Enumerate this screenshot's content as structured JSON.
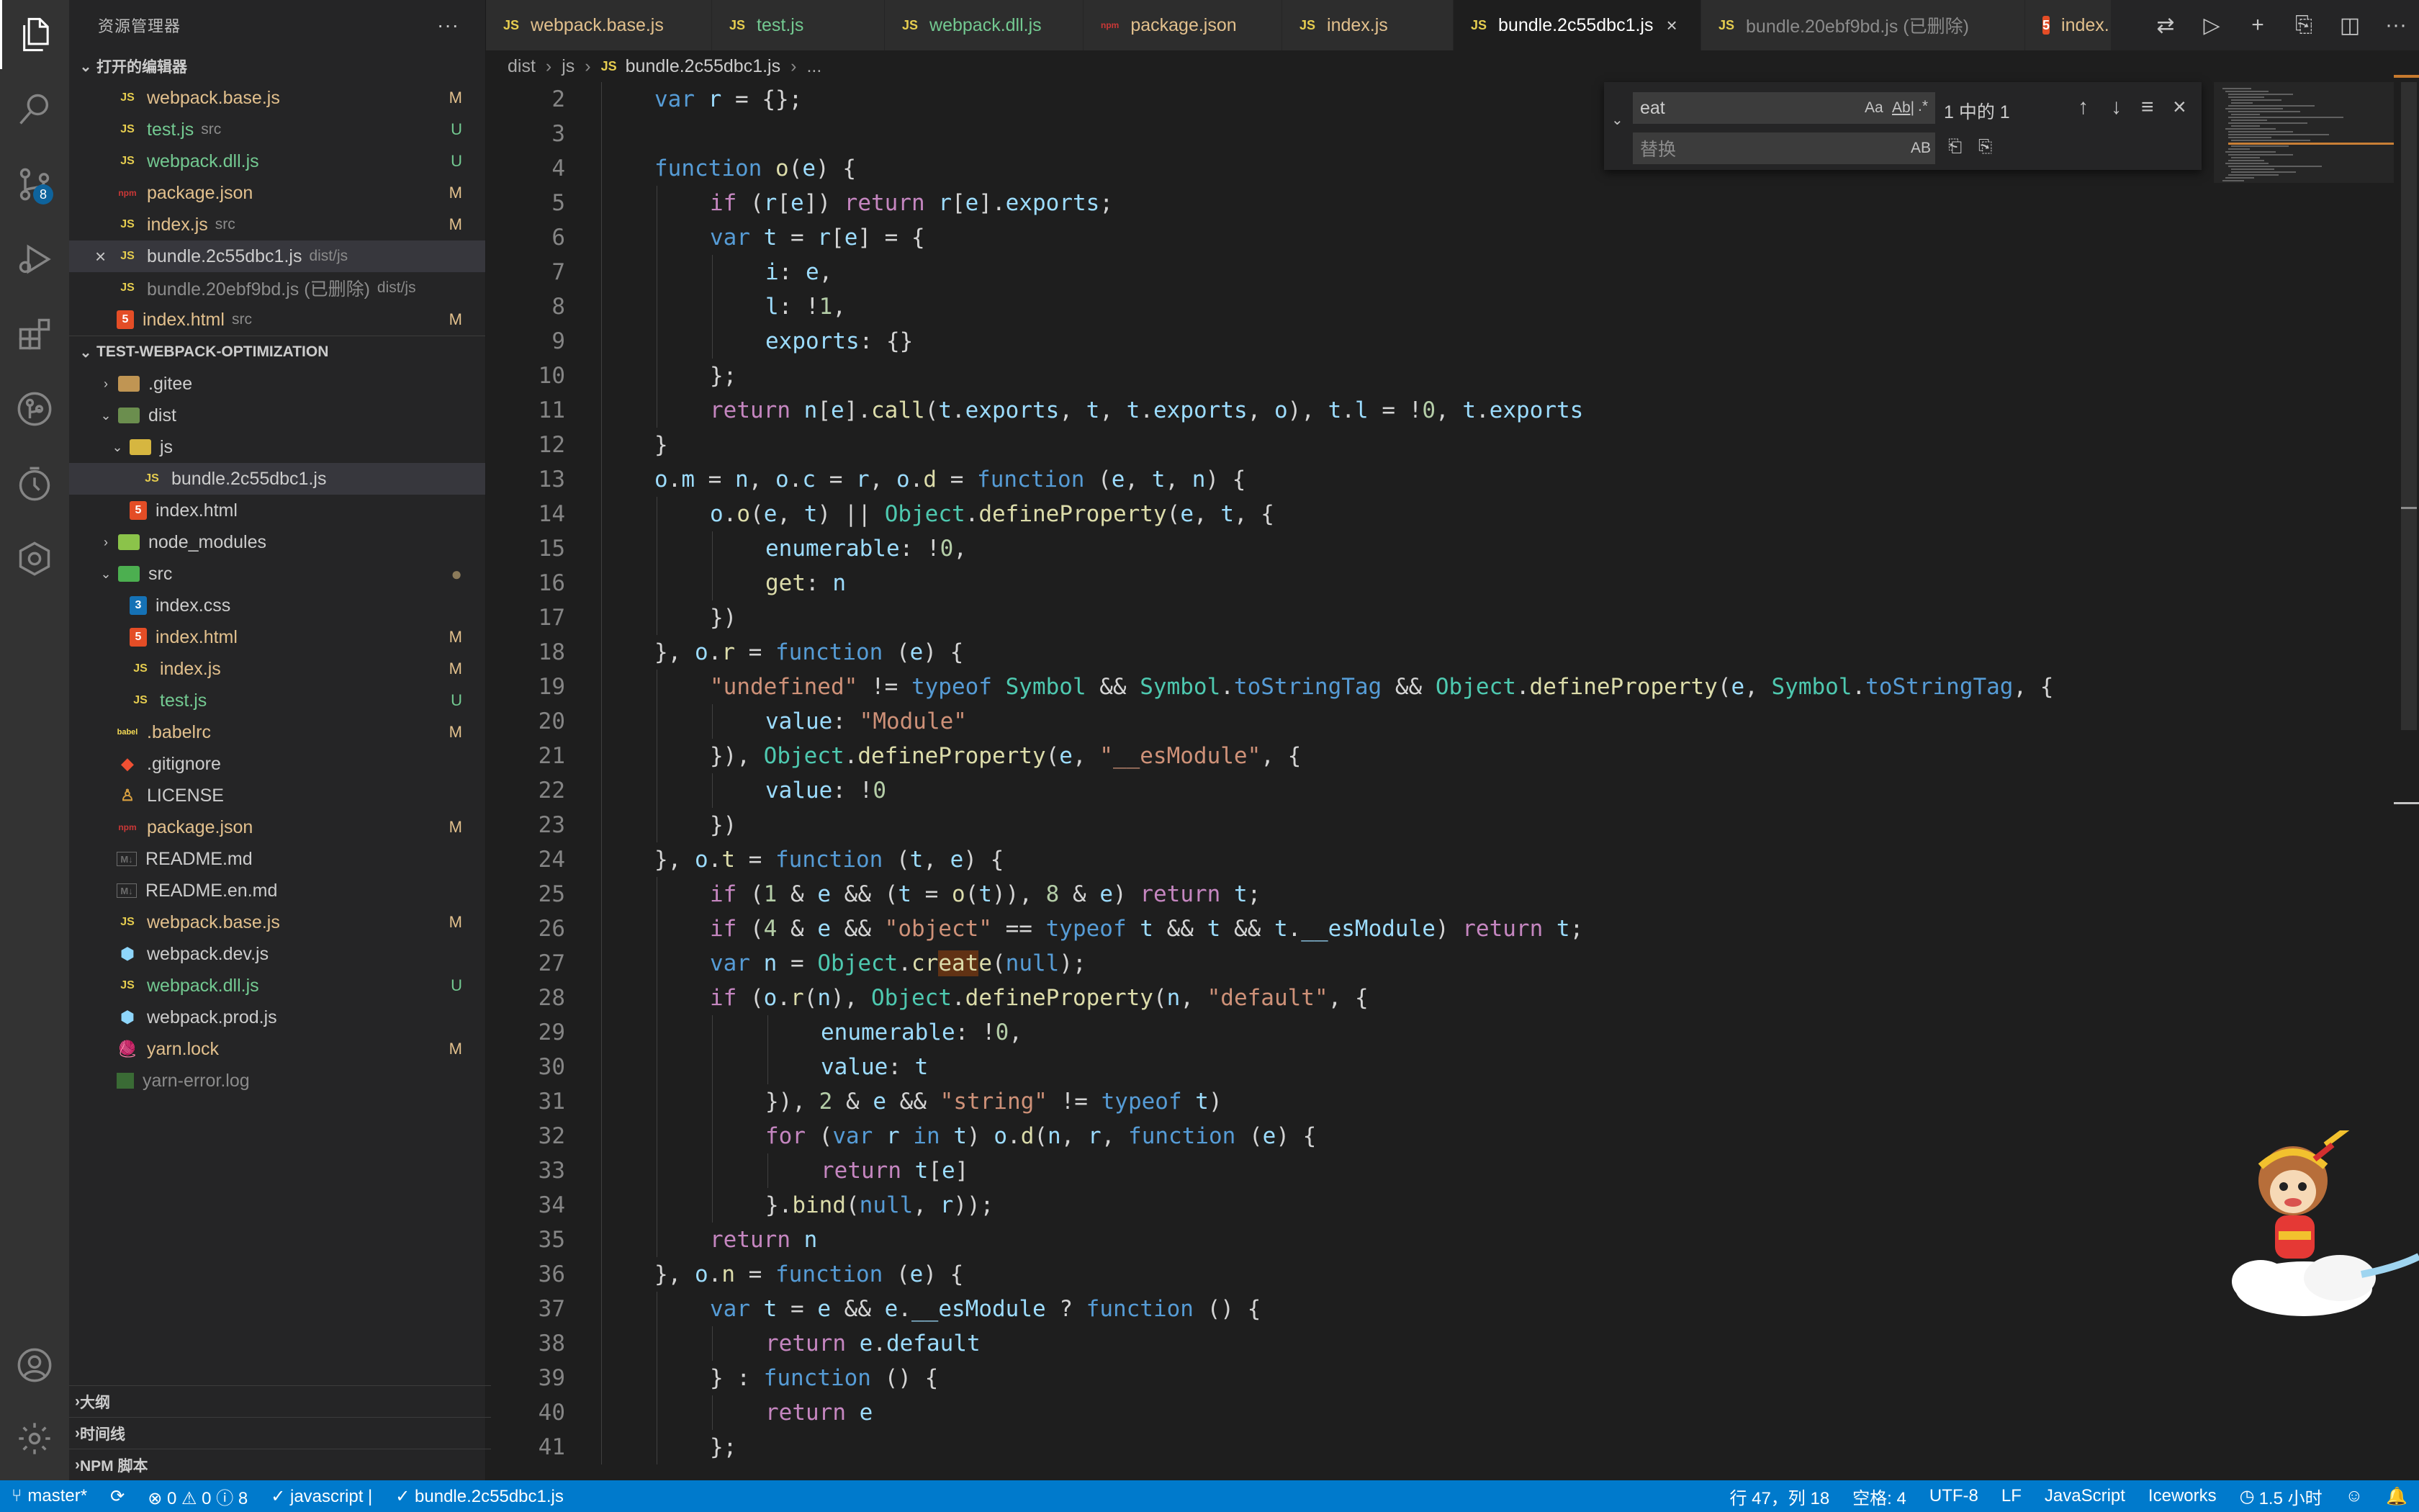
{
  "sidebar": {
    "title": "资源管理器",
    "more": "···",
    "open_editors": {
      "title": "打开的编辑器",
      "items": [
        {
          "name": "webpack.base.js",
          "desc": "",
          "status": "M",
          "type": "js"
        },
        {
          "name": "test.js",
          "desc": "src",
          "status": "U",
          "type": "js"
        },
        {
          "name": "webpack.dll.js",
          "desc": "",
          "status": "U",
          "type": "js"
        },
        {
          "name": "package.json",
          "desc": "",
          "status": "M",
          "type": "npm"
        },
        {
          "name": "index.js",
          "desc": "src",
          "status": "M",
          "type": "js"
        },
        {
          "name": "bundle.2c55dbc1.js",
          "desc": "dist/js",
          "status": "",
          "type": "js"
        },
        {
          "name": "bundle.20ebf9bd.js (已删除)",
          "desc": "dist/js",
          "status": "",
          "type": "js"
        },
        {
          "name": "index.html",
          "desc": "src",
          "status": "M",
          "type": "html"
        }
      ]
    },
    "project": {
      "title": "TEST-WEBPACK-OPTIMIZATION",
      "items": [
        {
          "name": ".gitee",
          "status": ""
        },
        {
          "name": "dist",
          "status": ""
        },
        {
          "name": "js",
          "status": ""
        },
        {
          "name": "bundle.2c55dbc1.js",
          "status": ""
        },
        {
          "name": "index.html",
          "status": ""
        },
        {
          "name": "node_modules",
          "status": ""
        },
        {
          "name": "src",
          "status": ""
        },
        {
          "name": "index.css",
          "status": ""
        },
        {
          "name": "index.html",
          "status": "M"
        },
        {
          "name": "index.js",
          "status": "M"
        },
        {
          "name": "test.js",
          "status": "U"
        },
        {
          "name": ".babelrc",
          "status": "M"
        },
        {
          "name": ".gitignore",
          "status": ""
        },
        {
          "name": "LICENSE",
          "status": ""
        },
        {
          "name": "package.json",
          "status": "M"
        },
        {
          "name": "README.md",
          "status": ""
        },
        {
          "name": "README.en.md",
          "status": ""
        },
        {
          "name": "webpack.base.js",
          "status": "M"
        },
        {
          "name": "webpack.dev.js",
          "status": ""
        },
        {
          "name": "webpack.dll.js",
          "status": "U"
        },
        {
          "name": "webpack.prod.js",
          "status": ""
        },
        {
          "name": "yarn.lock",
          "status": "M"
        },
        {
          "name": "yarn-error.log",
          "status": ""
        }
      ]
    },
    "outline": "大纲",
    "timeline": "时间线",
    "npm": "NPM 脚本"
  },
  "activity": {
    "scm_badge": "8"
  },
  "tabs": [
    {
      "label": "webpack.base.js",
      "icon": "JS"
    },
    {
      "label": "test.js",
      "icon": "JS"
    },
    {
      "label": "webpack.dll.js",
      "icon": "JS"
    },
    {
      "label": "package.json",
      "icon": "npm"
    },
    {
      "label": "index.js",
      "icon": "JS"
    },
    {
      "label": "bundle.2c55dbc1.js",
      "icon": "JS",
      "active": true
    },
    {
      "label": "bundle.20ebf9bd.js (已删除)",
      "icon": "JS"
    },
    {
      "label": "index.",
      "icon": "5"
    }
  ],
  "breadcrumb": [
    "dist",
    "js",
    "bundle.2c55dbc1.js",
    "..."
  ],
  "find": {
    "search_value": "eat",
    "replace_placeholder": "替换",
    "opt_case": "Aa",
    "opt_word": "Ab|",
    "opt_regex": ".*",
    "opt_preserve": "AB",
    "result": "1 中的 1"
  },
  "editor": {
    "lines": [
      {
        "n": "2",
        "indent": 1,
        "html": "<span class='kw'>var</span> <span class='vr'>r</span> = {};"
      },
      {
        "n": "3",
        "indent": 1,
        "html": ""
      },
      {
        "n": "4",
        "indent": 1,
        "html": "<span class='kw'>function</span> <span class='fn'>o</span>(<span class='vr'>e</span>) {"
      },
      {
        "n": "5",
        "indent": 2,
        "html": "<span class='kc'>if</span> (<span class='vr'>r</span>[<span class='vr'>e</span>]) <span class='kc'>return</span> <span class='vr'>r</span>[<span class='vr'>e</span>].<span class='vr'>exports</span>;"
      },
      {
        "n": "6",
        "indent": 2,
        "html": "<span class='kw'>var</span> <span class='vr'>t</span> = <span class='vr'>r</span>[<span class='vr'>e</span>] = {"
      },
      {
        "n": "7",
        "indent": 3,
        "html": "<span class='vr'>i</span>: <span class='vr'>e</span>,"
      },
      {
        "n": "8",
        "indent": 3,
        "html": "<span class='vr'>l</span>: !<span class='nm'>1</span>,"
      },
      {
        "n": "9",
        "indent": 3,
        "html": "<span class='vr'>exports</span>: {}"
      },
      {
        "n": "10",
        "indent": 2,
        "html": "};"
      },
      {
        "n": "11",
        "indent": 2,
        "html": "<span class='kc'>return</span> <span class='vr'>n</span>[<span class='vr'>e</span>].<span class='fn'>call</span>(<span class='vr'>t</span>.<span class='vr'>exports</span>, <span class='vr'>t</span>, <span class='vr'>t</span>.<span class='vr'>exports</span>, <span class='vr'>o</span>), <span class='vr'>t</span>.<span class='vr'>l</span> = !<span class='nm'>0</span>, <span class='vr'>t</span>.<span class='vr'>exports</span>"
      },
      {
        "n": "12",
        "indent": 1,
        "html": "}"
      },
      {
        "n": "13",
        "indent": 1,
        "html": "<span class='vr'>o</span>.<span class='vr'>m</span> = <span class='vr'>n</span>, <span class='vr'>o</span>.<span class='vr'>c</span> = <span class='vr'>r</span>, <span class='vr'>o</span>.<span class='fn'>d</span> = <span class='kw'>function</span> (<span class='vr'>e</span>, <span class='vr'>t</span>, <span class='vr'>n</span>) {"
      },
      {
        "n": "14",
        "indent": 2,
        "html": "<span class='vr'>o</span>.<span class='fn'>o</span>(<span class='vr'>e</span>, <span class='vr'>t</span>) || <span class='cl'>Object</span>.<span class='fn'>defineProperty</span>(<span class='vr'>e</span>, <span class='vr'>t</span>, {"
      },
      {
        "n": "15",
        "indent": 3,
        "html": "<span class='vr'>enumerable</span>: !<span class='nm'>0</span>,"
      },
      {
        "n": "16",
        "indent": 3,
        "html": "<span class='fn'>get</span>: <span class='vr'>n</span>"
      },
      {
        "n": "17",
        "indent": 2,
        "html": "})"
      },
      {
        "n": "18",
        "indent": 1,
        "html": "}, <span class='vr'>o</span>.<span class='fn'>r</span> = <span class='kw'>function</span> (<span class='vr'>e</span>) {"
      },
      {
        "n": "19",
        "indent": 2,
        "html": "<span class='st'>\"undefined\"</span> != <span class='kw'>typeof</span> <span class='cl'>Symbol</span> &amp;&amp; <span class='cl'>Symbol</span>.<span class='kw'>toStringTag</span> &amp;&amp; <span class='cl'>Object</span>.<span class='fn'>defineProperty</span>(<span class='vr'>e</span>, <span class='cl'>Symbol</span>.<span class='kw'>toStringTag</span>, {"
      },
      {
        "n": "20",
        "indent": 3,
        "html": "<span class='vr'>value</span>: <span class='st'>\"Module\"</span>"
      },
      {
        "n": "21",
        "indent": 2,
        "html": "}), <span class='cl'>Object</span>.<span class='fn'>defineProperty</span>(<span class='vr'>e</span>, <span class='st'>\"__esModule\"</span>, {"
      },
      {
        "n": "22",
        "indent": 3,
        "html": "<span class='vr'>value</span>: !<span class='nm'>0</span>"
      },
      {
        "n": "23",
        "indent": 2,
        "html": "})"
      },
      {
        "n": "24",
        "indent": 1,
        "html": "}, <span class='vr'>o</span>.<span class='fn'>t</span> = <span class='kw'>function</span> (<span class='vr'>t</span>, <span class='vr'>e</span>) {"
      },
      {
        "n": "25",
        "indent": 2,
        "html": "<span class='kc'>if</span> (<span class='nm'>1</span> &amp; <span class='vr'>e</span> &amp;&amp; (<span class='vr'>t</span> = <span class='fn'>o</span>(<span class='vr'>t</span>)), <span class='nm'>8</span> &amp; <span class='vr'>e</span>) <span class='kc'>return</span> <span class='vr'>t</span>;"
      },
      {
        "n": "26",
        "indent": 2,
        "html": "<span class='kc'>if</span> (<span class='nm'>4</span> &amp; <span class='vr'>e</span> &amp;&amp; <span class='st'>\"object\"</span> == <span class='kw'>typeof</span> <span class='vr'>t</span> &amp;&amp; <span class='vr'>t</span> &amp;&amp; <span class='vr'>t</span>.<span class='vr'>__esModule</span>) <span class='kc'>return</span> <span class='vr'>t</span>;"
      },
      {
        "n": "27",
        "indent": 2,
        "html": "<span class='kw'>var</span> <span class='vr'>n</span> = <span class='cl'>Object</span>.<span class='fn'>cr<span class='hl'>eat</span>e</span>(<span class='kw'>null</span>);"
      },
      {
        "n": "28",
        "indent": 2,
        "html": "<span class='kc'>if</span> (<span class='vr'>o</span>.<span class='fn'>r</span>(<span class='vr'>n</span>), <span class='cl'>Object</span>.<span class='fn'>defineProperty</span>(<span class='vr'>n</span>, <span class='st'>\"default\"</span>, {"
      },
      {
        "n": "29",
        "indent": 4,
        "html": "<span class='vr'>enumerable</span>: !<span class='nm'>0</span>,"
      },
      {
        "n": "30",
        "indent": 4,
        "html": "<span class='vr'>value</span>: <span class='vr'>t</span>"
      },
      {
        "n": "31",
        "indent": 3,
        "html": "}), <span class='nm'>2</span> &amp; <span class='vr'>e</span> &amp;&amp; <span class='st'>\"string\"</span> != <span class='kw'>typeof</span> <span class='vr'>t</span>)"
      },
      {
        "n": "32",
        "indent": 3,
        "html": "<span class='kc'>for</span> (<span class='kw'>var</span> <span class='vr'>r</span> <span class='kw'>in</span> <span class='vr'>t</span>) <span class='vr'>o</span>.<span class='fn'>d</span>(<span class='vr'>n</span>, <span class='vr'>r</span>, <span class='kw'>function</span> (<span class='vr'>e</span>) {"
      },
      {
        "n": "33",
        "indent": 4,
        "html": "<span class='kc'>return</span> <span class='vr'>t</span>[<span class='vr'>e</span>]"
      },
      {
        "n": "34",
        "indent": 3,
        "html": "}.<span class='fn'>bind</span>(<span class='kw'>null</span>, <span class='vr'>r</span>));"
      },
      {
        "n": "35",
        "indent": 2,
        "html": "<span class='kc'>return</span> <span class='vr'>n</span>"
      },
      {
        "n": "36",
        "indent": 1,
        "html": "}, <span class='vr'>o</span>.<span class='fn'>n</span> = <span class='kw'>function</span> (<span class='vr'>e</span>) {"
      },
      {
        "n": "37",
        "indent": 2,
        "html": "<span class='kw'>var</span> <span class='vr'>t</span> = <span class='vr'>e</span> &amp;&amp; <span class='vr'>e</span>.<span class='vr'>__esModule</span> ? <span class='kw'>function</span> () {"
      },
      {
        "n": "38",
        "indent": 3,
        "html": "<span class='kc'>return</span> <span class='vr'>e</span>.<span class='vr'>default</span>"
      },
      {
        "n": "39",
        "indent": 2,
        "html": "} : <span class='kw'>function</span> () {"
      },
      {
        "n": "40",
        "indent": 3,
        "html": "<span class='kc'>return</span> <span class='vr'>e</span>"
      },
      {
        "n": "41",
        "indent": 2,
        "html": "};"
      }
    ]
  },
  "status": {
    "branch": "master*",
    "problems": "⊗ 0 ⚠ 0 ⓘ 8",
    "lang_check": "✓ javascript |",
    "file_check": "✓ bundle.2c55dbc1.js",
    "position": "行 47，列 18",
    "spaces": "空格: 4",
    "encoding": "UTF-8",
    "eol": "LF",
    "language": "JavaScript",
    "iceworks": "Iceworks",
    "time": "1.5 小时"
  },
  "colors": {
    "accent": "#007acc",
    "modified": "#e2c08d",
    "untracked": "#73c991",
    "js_icon": "#e6cd4f"
  }
}
